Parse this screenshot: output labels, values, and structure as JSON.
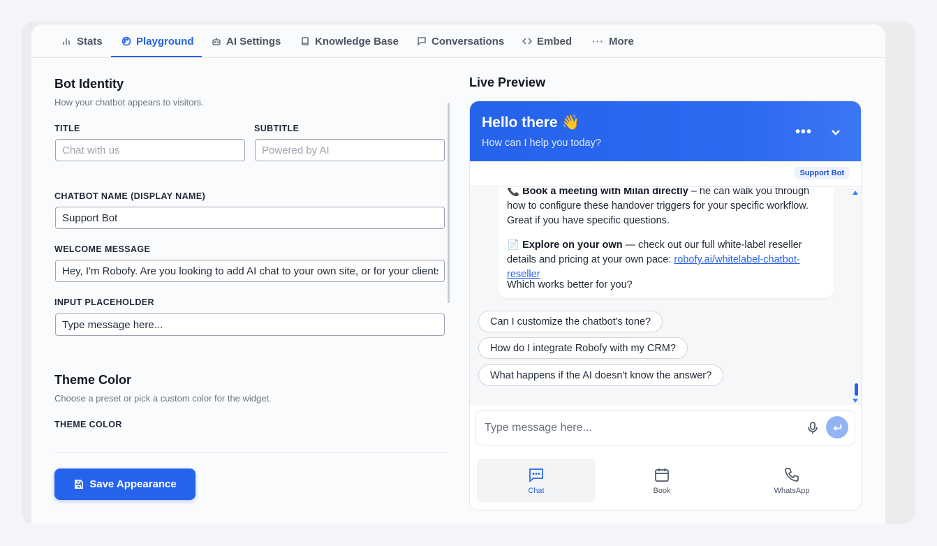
{
  "tabs": [
    {
      "label": "Stats",
      "icon": "bar-chart-icon"
    },
    {
      "label": "Playground",
      "icon": "palette-icon"
    },
    {
      "label": "AI Settings",
      "icon": "bot-icon"
    },
    {
      "label": "Knowledge Base",
      "icon": "book-icon"
    },
    {
      "label": "Conversations",
      "icon": "message-icon"
    },
    {
      "label": "Embed",
      "icon": "code-icon"
    },
    {
      "label": "More",
      "icon": "more-icon"
    }
  ],
  "active_tab": "Playground",
  "identity": {
    "heading": "Bot Identity",
    "description": "How your chatbot appears to visitors.",
    "title_label": "TITLE",
    "title_placeholder": "Chat with us",
    "subtitle_label": "SUBTITLE",
    "subtitle_placeholder": "Powered by AI",
    "name_label": "CHATBOT NAME (DISPLAY NAME)",
    "name_value": "Support Bot",
    "welcome_label": "WELCOME MESSAGE",
    "welcome_value": "Hey, I'm Robofy. Are you looking to add AI chat to your own site, or for your clients?",
    "placeholder_label": "INPUT PLACEHOLDER",
    "placeholder_value": "Type message here..."
  },
  "theme": {
    "heading": "Theme Color",
    "description": "Choose a preset or pick a custom color for the widget.",
    "color_label": "THEME COLOR",
    "accent": "#2563eb"
  },
  "save_label": "Save Appearance",
  "preview": {
    "heading": "Live Preview",
    "header_title": "Hello there 👋",
    "header_subtitle": "How can I help you today?",
    "more_glyph": "•••",
    "bot_badge": "Support Bot",
    "message": {
      "line1_icon": "📞",
      "line1_bold": "Book a meeting with Milan directly",
      "line1_rest": " – he can walk you through how to configure these handover triggers for your specific workflow. Great if you have specific questions.",
      "line2_icon": "📄",
      "line2_bold": "Explore on your own",
      "line2_rest": " — check out our full white-label reseller details and pricing at your own pace: ",
      "line2_link": "robofy.ai/whitelabel-chatbot-reseller",
      "line3": "Which works better for you?"
    },
    "suggestions": [
      "Can I customize the chatbot's tone?",
      "How do I integrate Robofy with my CRM?",
      "What happens if the AI doesn't know the answer?"
    ],
    "input_placeholder": "Type message here...",
    "nav": [
      {
        "label": "Chat",
        "icon": "chat-icon"
      },
      {
        "label": "Book",
        "icon": "calendar-icon"
      },
      {
        "label": "WhatsApp",
        "icon": "phone-icon"
      }
    ]
  }
}
